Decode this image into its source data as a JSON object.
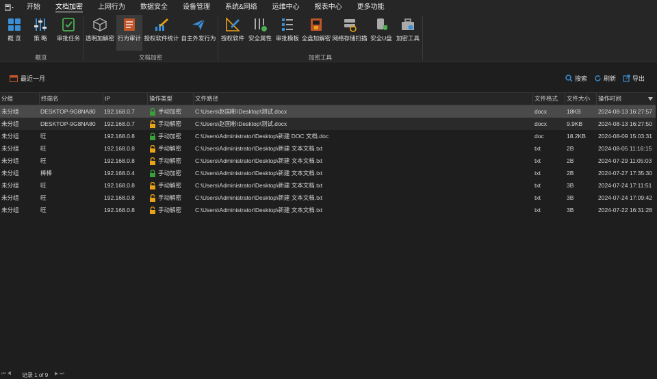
{
  "menu": {
    "app_icon": "app-menu-icon",
    "items": [
      "开始",
      "文档加密",
      "上网行为",
      "数据安全",
      "设备管理",
      "系统&网络",
      "运维中心",
      "报表中心",
      "更多功能"
    ],
    "active_index": 1
  },
  "ribbon": {
    "groups": [
      {
        "label": "概览",
        "buttons": [
          {
            "label": "概 览",
            "icon": "grid-icon"
          },
          {
            "label": "策 略",
            "icon": "sliders-icon"
          },
          {
            "label": "审批任务",
            "icon": "checklist-icon"
          }
        ]
      },
      {
        "label": "文档加密",
        "buttons": [
          {
            "label": "透明加解密",
            "icon": "cube-icon"
          },
          {
            "label": "行为审计",
            "icon": "document-audit-icon",
            "selected": true
          },
          {
            "label": "授权软件统计",
            "icon": "pen-chart-icon"
          },
          {
            "label": "自主外发行为",
            "icon": "paper-plane-icon"
          }
        ]
      },
      {
        "label": "加密工具",
        "buttons": [
          {
            "label": "授权软件",
            "icon": "pen-ruler-icon"
          },
          {
            "label": "安全属性",
            "icon": "lock-settings-icon"
          },
          {
            "label": "审批模板",
            "icon": "template-icon"
          },
          {
            "label": "全盘加解密",
            "icon": "disk-lock-icon"
          },
          {
            "label": "网络存储扫描",
            "icon": "storage-scan-icon"
          },
          {
            "label": "安全U盘",
            "icon": "usb-shield-icon"
          },
          {
            "label": "加密工具",
            "icon": "toolbox-icon"
          }
        ]
      }
    ]
  },
  "toolbar": {
    "period_label": "最近一月",
    "search_label": "搜索",
    "refresh_label": "刷新",
    "export_label": "导出"
  },
  "table": {
    "columns": [
      "分组",
      "终端名",
      "IP",
      "操作类型",
      "文件路径",
      "文件格式",
      "文件大小",
      "操作时间"
    ],
    "rows": [
      {
        "group": "未分组",
        "terminal": "DESKTOP-9G8NA80",
        "ip": "192.168.0.7",
        "op": "手动加密",
        "path": "C:\\Users\\赵国彬\\Desktop\\测试.docx",
        "format": "docx",
        "size": "18KB",
        "time": "2024-08-13 16:27:57",
        "lock": "locked"
      },
      {
        "group": "未分组",
        "terminal": "DESKTOP-9G8NA80",
        "ip": "192.168.0.7",
        "op": "手动解密",
        "path": "C:\\Users\\赵国彬\\Desktop\\测试.docx",
        "format": "docx",
        "size": "9.9KB",
        "time": "2024-08-13 16:27:50",
        "lock": "unlocked"
      },
      {
        "group": "未分组",
        "terminal": "旺",
        "ip": "192.168.0.8",
        "op": "手动加密",
        "path": "C:\\Users\\Administrator\\Desktop\\新建 DOC 文档.doc",
        "format": "doc",
        "size": "18.2KB",
        "time": "2024-08-09 15:03:31",
        "lock": "locked"
      },
      {
        "group": "未分组",
        "terminal": "旺",
        "ip": "192.168.0.8",
        "op": "手动解密",
        "path": "C:\\Users\\Administrator\\Desktop\\新建 文本文档.txt",
        "format": "txt",
        "size": "2B",
        "time": "2024-08-05 11:16:15",
        "lock": "unlocked"
      },
      {
        "group": "未分组",
        "terminal": "旺",
        "ip": "192.168.0.8",
        "op": "手动解密",
        "path": "C:\\Users\\Administrator\\Desktop\\新建 文本文档.txt",
        "format": "txt",
        "size": "2B",
        "time": "2024-07-29 11:05:03",
        "lock": "unlocked"
      },
      {
        "group": "未分组",
        "terminal": "棒棒",
        "ip": "192.168.0.4",
        "op": "手动加密",
        "path": "C:\\Users\\Administrator\\Desktop\\新建 文本文档.txt",
        "format": "txt",
        "size": "2B",
        "time": "2024-07-27 17:35:30",
        "lock": "locked"
      },
      {
        "group": "未分组",
        "terminal": "旺",
        "ip": "192.168.0.8",
        "op": "手动解密",
        "path": "C:\\Users\\Administrator\\Desktop\\新建 文本文档.txt",
        "format": "txt",
        "size": "3B",
        "time": "2024-07-24 17:11:51",
        "lock": "unlocked"
      },
      {
        "group": "未分组",
        "terminal": "旺",
        "ip": "192.168.0.8",
        "op": "手动解密",
        "path": "C:\\Users\\Administrator\\Desktop\\新建 文本文档.txt",
        "format": "txt",
        "size": "3B",
        "time": "2024-07-24 17:09:42",
        "lock": "unlocked"
      },
      {
        "group": "未分组",
        "terminal": "旺",
        "ip": "192.168.0.8",
        "op": "手动解密",
        "path": "C:\\Users\\Administrator\\Desktop\\新建 文本文档.txt",
        "format": "txt",
        "size": "3B",
        "time": "2024-07-22 16:31:28",
        "lock": "unlocked"
      }
    ]
  },
  "status": {
    "record_text": "记录 1 of 9"
  },
  "colors": {
    "lock_locked": "#3aa13a",
    "lock_unlocked": "#e8a317",
    "accent": "#3b8fd6"
  }
}
